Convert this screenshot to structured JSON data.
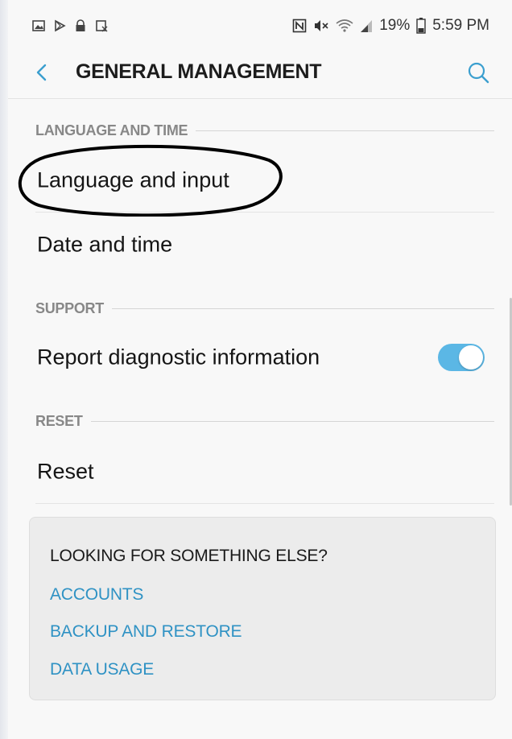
{
  "colors": {
    "accent": "#3b9fcf",
    "toggle_on": "#5bb7e5",
    "link": "#2f92c4",
    "section_title": "#888888"
  },
  "status_bar": {
    "left_icons": [
      "gallery-icon",
      "play-store-icon",
      "lock-icon",
      "screenshot-icon"
    ],
    "right_icons": [
      "nfc-icon",
      "mute-icon",
      "wifi-icon",
      "signal-icon",
      "battery-icon"
    ],
    "battery": "19%",
    "time": "5:59 PM"
  },
  "header": {
    "title": "GENERAL MANAGEMENT",
    "back_icon": "back-arrow-icon",
    "search_icon": "search-icon"
  },
  "sections": {
    "language_and_time": {
      "title": "LANGUAGE AND TIME",
      "items": [
        {
          "label": "Language and input"
        },
        {
          "label": "Date and time"
        }
      ]
    },
    "support": {
      "title": "SUPPORT",
      "items": [
        {
          "label": "Report diagnostic information",
          "toggle": true
        }
      ]
    },
    "reset": {
      "title": "RESET",
      "items": [
        {
          "label": "Reset"
        }
      ]
    }
  },
  "suggestions": {
    "title": "LOOKING FOR SOMETHING ELSE?",
    "links": [
      "ACCOUNTS",
      "BACKUP AND RESTORE",
      "DATA USAGE"
    ]
  }
}
